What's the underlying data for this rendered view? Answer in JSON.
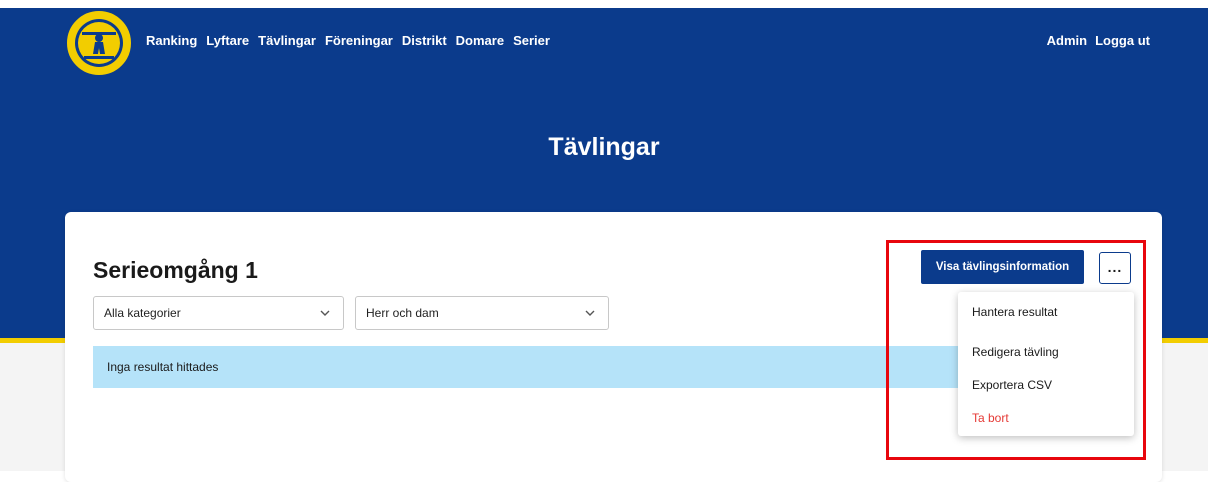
{
  "nav": {
    "items": [
      "Ranking",
      "Lyftare",
      "Tävlingar",
      "Föreningar",
      "Distrikt",
      "Domare",
      "Serier"
    ],
    "user_items": [
      "Admin",
      "Logga ut"
    ]
  },
  "header": {
    "title": "Tävlingar"
  },
  "competition": {
    "title": "Serieomgång 1",
    "show_info_label": "Visa tävlingsinformation",
    "more_label": "..."
  },
  "filters": {
    "category": "Alla kategorier",
    "gender": "Herr och dam"
  },
  "alert": {
    "text": "Inga resultat hittades"
  },
  "menu": {
    "items": [
      {
        "label": "Hantera resultat",
        "danger": false
      },
      {
        "label": "Redigera tävling",
        "danger": false
      },
      {
        "label": "Exportera CSV",
        "danger": false
      },
      {
        "label": "Ta bort",
        "danger": true
      }
    ]
  },
  "colors": {
    "brand_blue": "#0b3b8c",
    "accent_yellow": "#f2cd00",
    "alert_bg": "#b5e3f9",
    "danger": "#e53935",
    "highlight": "#e8060d"
  },
  "icons": {
    "logo": "federation-logo",
    "dropdown": "chevron-down-icon",
    "more": "ellipsis-icon"
  }
}
